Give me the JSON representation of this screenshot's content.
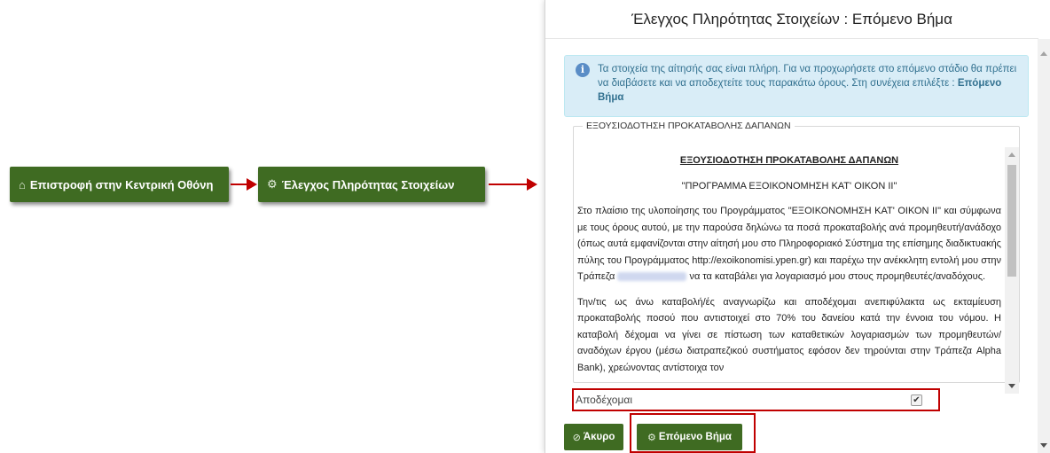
{
  "flow": {
    "home_button": {
      "icon": "home-icon",
      "label": "Επιστροφή στην Κεντρική Οθόνη"
    },
    "check_button": {
      "icon": "gear-icon",
      "label": "Έλεγχος Πληρότητας Στοιχείων"
    }
  },
  "modal": {
    "title": "Έλεγχος Πληρότητας Στοιχείων : Επόμενο Βήμα",
    "alert": {
      "icon": "info-icon",
      "text": "Τα στοιχεία της αίτησής σας είναι πλήρη. Για να προχωρήσετε στο επόμενο στάδιο θα πρέπει να διαβάσετε και να αποδεχτείτε τους παρακάτω όρους. Στη συνέχεια επιλέξτε :",
      "next_word": "Επόμενο Βήμα"
    },
    "terms": {
      "legend": "ΕΞΟΥΣΙΟΔΟΤΗΣΗ ΠΡΟΚΑΤΑΒΟΛΗΣ ΔΑΠΑΝΩΝ",
      "heading": "ΕΞΟΥΣΙΟΔΟΤΗΣΗ ΠΡΟΚΑΤΑΒΟΛΗΣ ΔΑΠΑΝΩΝ",
      "program": "\"ΠΡΟΓΡΑΜΜΑ ΕΞΟΙΚΟΝΟΜΗΣΗ ΚΑΤ' ΟΙΚΟΝ ΙΙ\"",
      "paragraph1_a": "Στο πλαίσιο της υλοποίησης του Προγράμματος \"ΕΞΟΙΚΟΝΟΜΗΣΗ ΚΑΤ' ΟΙΚΟΝ ΙΙ\" και σύμφωνα με τους όρους αυτού, με την παρούσα δηλώνω τα ποσά προκαταβολής ανά προμηθευτή/ανάδοχο (όπως αυτά εμφανίζονται στην αίτησή μου στο Πληροφοριακό Σύστημα της επίσημης διαδικτυακής πύλης του Προγράμματος http://exoikonomisi.ypen.gr) και παρέχω την ανέκκλητη εντολή μου στην Τράπεζα",
      "paragraph1_b": "να τα καταβάλει για λογαριασμό μου στους προμηθευτές/αναδόχους.",
      "paragraph2": "Την/τις ως άνω καταβολή/ές αναγνωρίζω και αποδέχομαι ανεπιφύλακτα ως εκταμίευση προκαταβολής ποσού που αντιστοιχεί στο 70% του δανείου κατά την έννοια του νόμου. Η καταβολή δέχομαι να γίνει σε πίστωση των καταθετικών λογαριασμών των προμηθευτών/αναδόχων έργου (μέσω διατραπεζικού συστήματος εφόσον δεν τηρούνται στην Τράπεζα Alpha Bank), χρεώνοντας αντίστοιχα τον"
    },
    "accept": {
      "label": "Αποδέχομαι",
      "checked": true,
      "check_mark": "✔"
    },
    "cancel_button": {
      "icon": "cancel-icon",
      "label": "Άκυρο"
    },
    "next_button": {
      "icon": "gear-icon",
      "label": "Επόμενο Βήμα"
    }
  },
  "colors": {
    "button_green": "#3f6b22",
    "highlight_red": "#c00000",
    "alert_bg": "#d9edf7"
  }
}
